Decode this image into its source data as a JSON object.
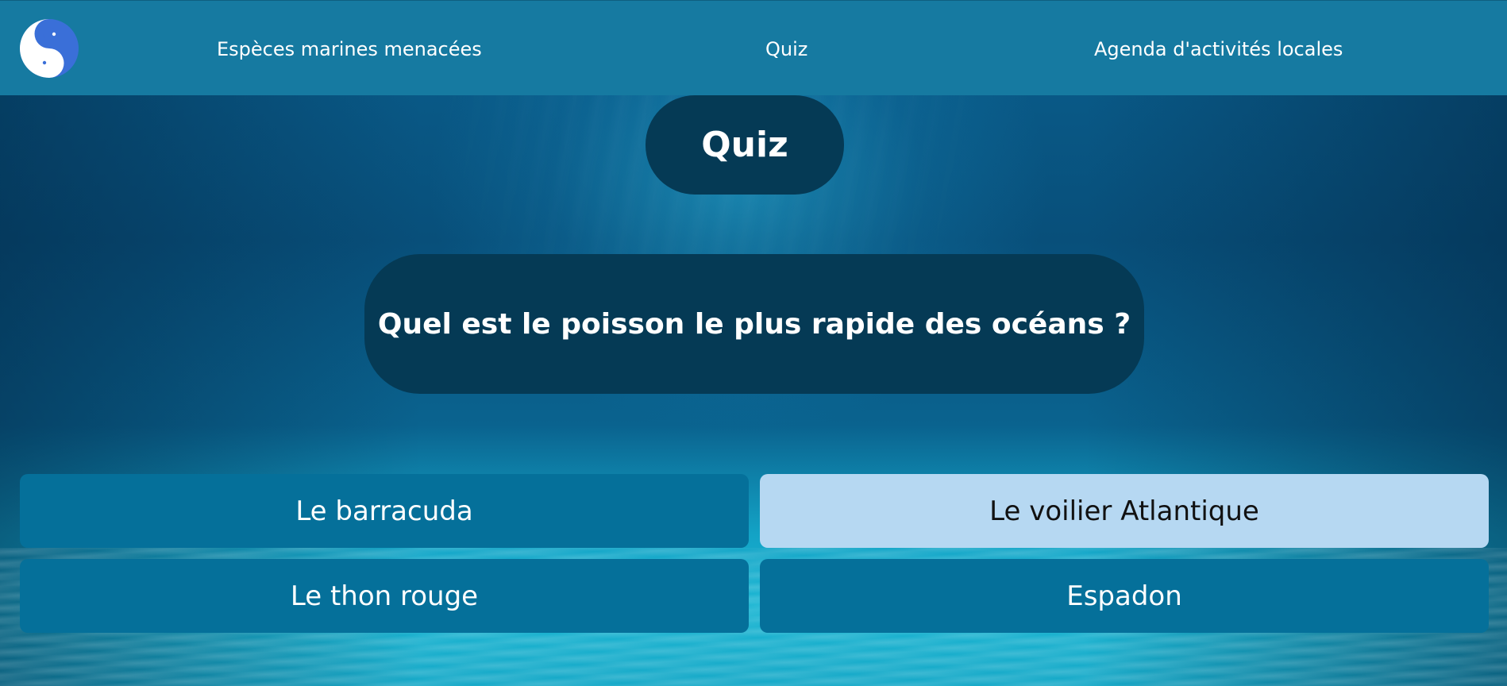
{
  "nav": {
    "links": [
      {
        "label": "Espèces marines menacées"
      },
      {
        "label": "Quiz"
      },
      {
        "label": "Agenda d'activités locales"
      }
    ],
    "logo_icon": "dolphin-yin-yang-icon"
  },
  "quiz": {
    "title": "Quiz",
    "question": "Quel est le poisson le plus rapide des océans ?",
    "answers": [
      {
        "label": "Le barracuda",
        "selected": false
      },
      {
        "label": "Le voilier Atlantique",
        "selected": true
      },
      {
        "label": "Le thon rouge",
        "selected": false
      },
      {
        "label": "Espadon",
        "selected": false
      }
    ]
  },
  "colors": {
    "header": "#167aa1",
    "panel": "#053a55",
    "answer": "#05709a",
    "answer_selected": "#b6d8f2"
  }
}
